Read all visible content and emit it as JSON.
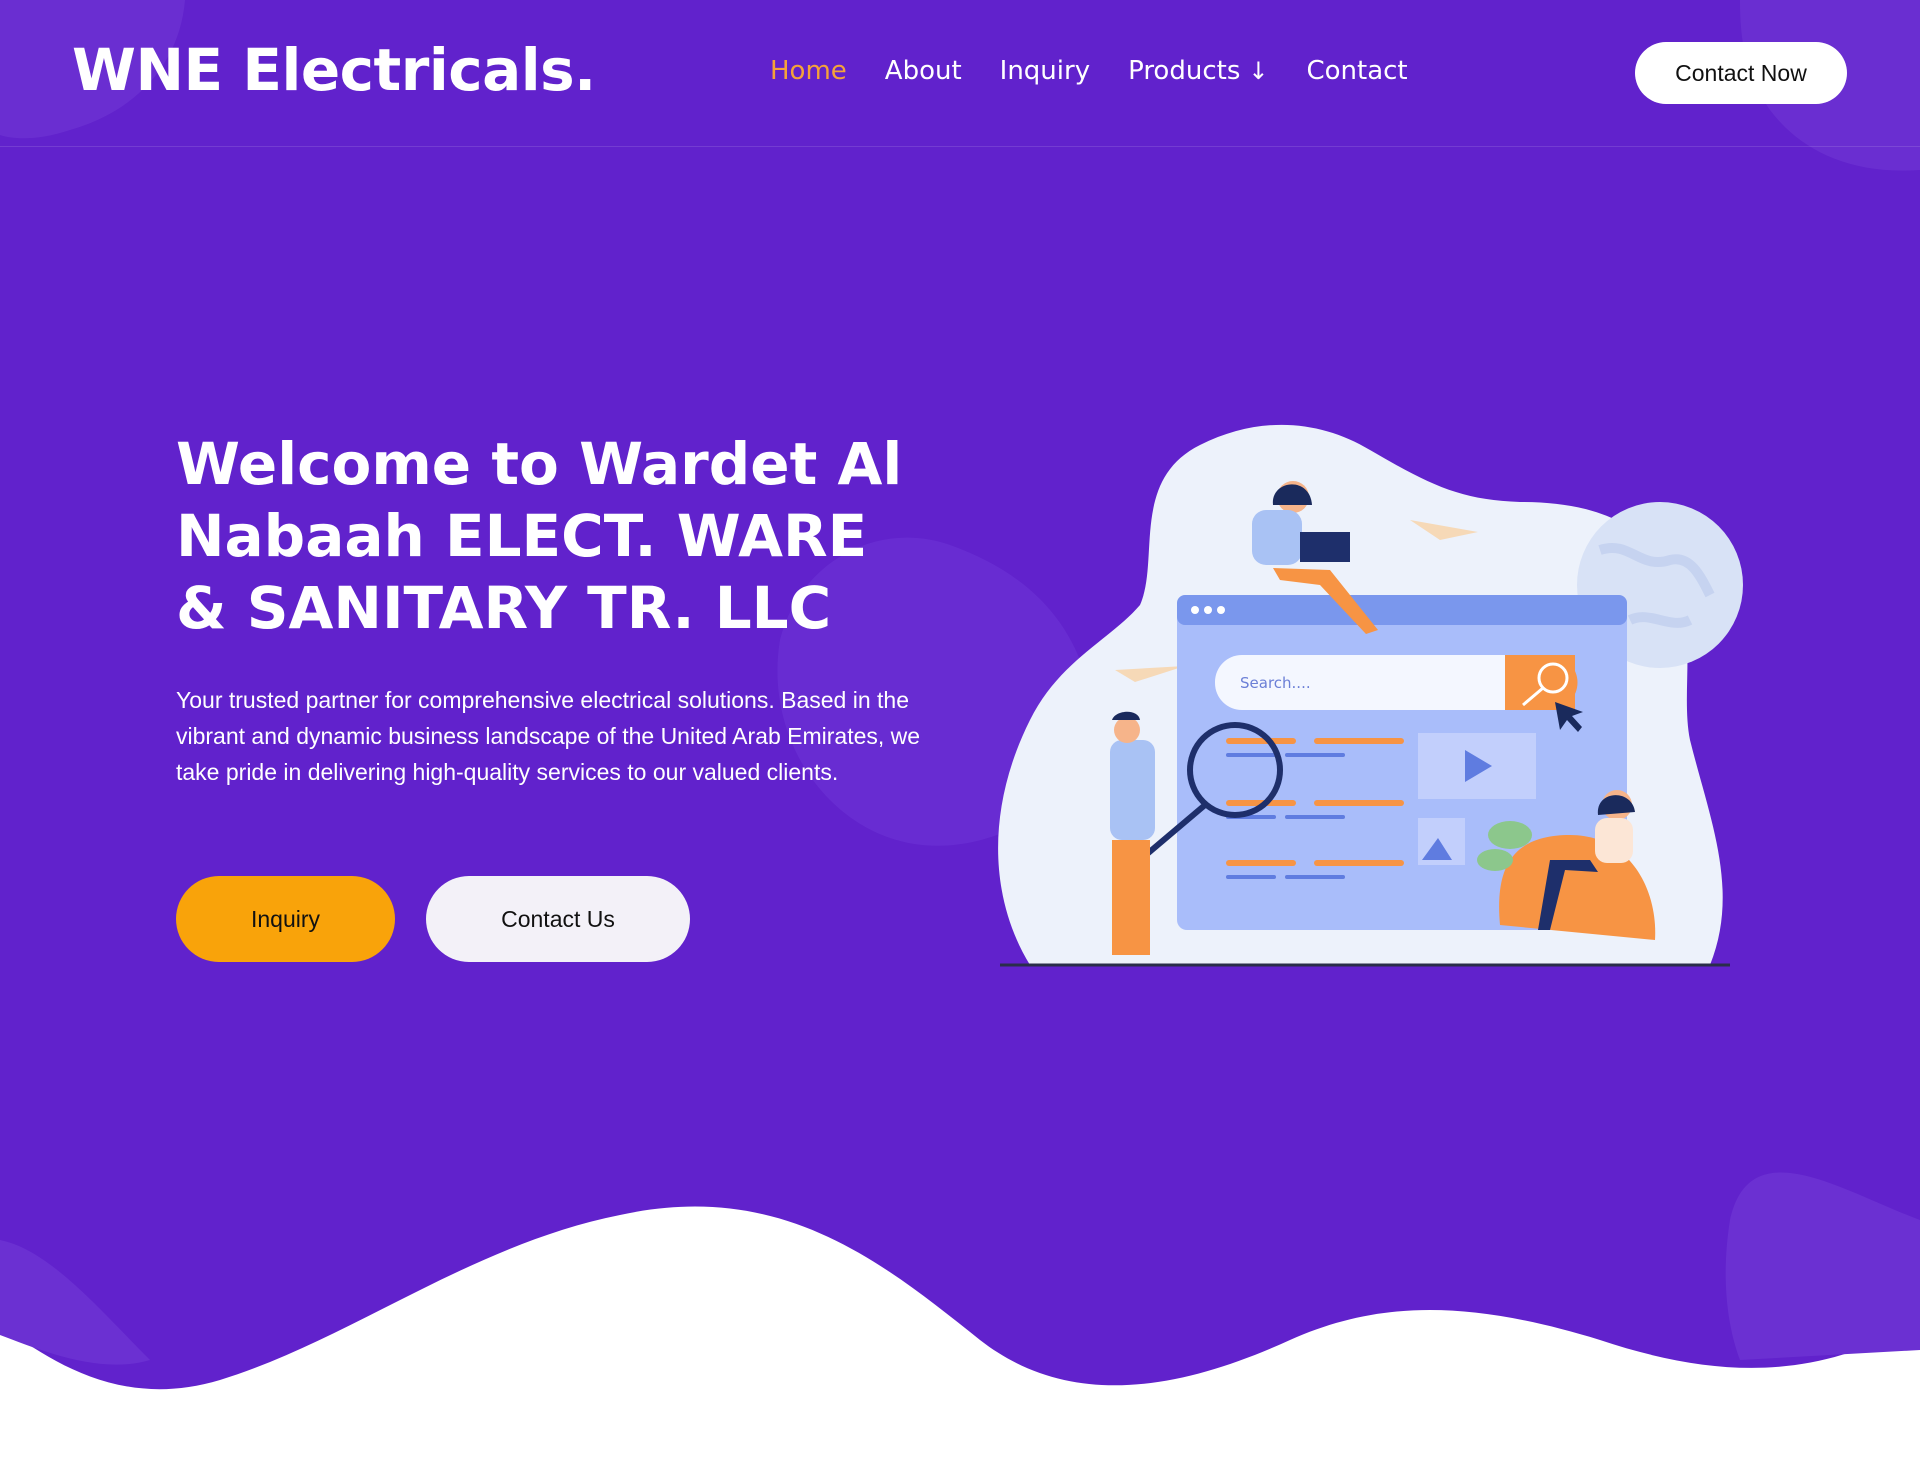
{
  "brand": {
    "logo": "WNE Electricals."
  },
  "nav": {
    "items": [
      {
        "label": "Home",
        "active": true
      },
      {
        "label": "About"
      },
      {
        "label": "Inquiry"
      },
      {
        "label": "Products",
        "icon": "arrow-down-icon"
      },
      {
        "label": "Contact"
      }
    ],
    "cta": "Contact Now"
  },
  "hero": {
    "title": "Welcome to Wardet Al Nabaah ELECT. WARE & SANITARY TR. LLC",
    "description": "Your trusted partner for comprehensive electrical solutions. Based in the vibrant and dynamic business landscape of the United Arab Emirates, we take pride in delivering high-quality services to our valued clients.",
    "primary_button": "Inquiry",
    "secondary_button": "Contact Us"
  },
  "illustration": {
    "search_placeholder": "Search...."
  },
  "colors": {
    "background": "#6122cc",
    "accent": "#f9a30a",
    "nav_active": "#f5a23a",
    "white": "#ffffff"
  }
}
